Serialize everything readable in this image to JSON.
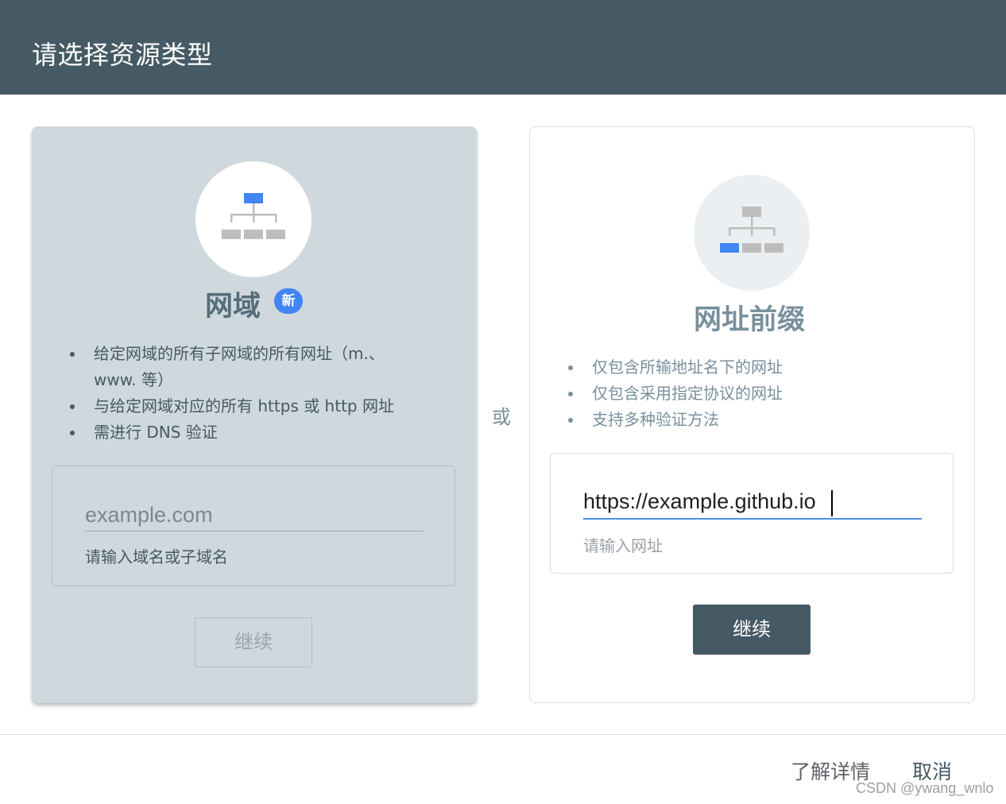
{
  "header": {
    "title": "请选择资源类型"
  },
  "domain_card": {
    "title": "网域",
    "badge": "新",
    "bullets": [
      "给定网域的所有子网域的所有网址（m.、www. 等）",
      "与给定网域对应的所有 https 或 http 网址",
      "需进行 DNS 验证"
    ],
    "input": {
      "placeholder": "example.com",
      "value": ""
    },
    "helper": "请输入域名或子域名",
    "continue_label": "继续",
    "icon": "sitemap-icon-top-highlight"
  },
  "separator": {
    "or_label": "或"
  },
  "prefix_card": {
    "title": "网址前缀",
    "bullets": [
      "仅包含所输地址名下的网址",
      "仅包含采用指定协议的网址",
      "支持多种验证方法"
    ],
    "input": {
      "placeholder": "",
      "value": "https://example.github.io"
    },
    "helper": "请输入网址",
    "continue_label": "继续",
    "icon": "sitemap-icon-bottom-highlight"
  },
  "footer": {
    "learn_more_label": "了解详情",
    "cancel_label": "取消"
  },
  "watermark": "CSDN @ywang_wnlo",
  "colors": {
    "header_bg": "#455a64",
    "domain_card_bg": "#cfd8dc",
    "highlight_blue": "#4285f4",
    "primary_button": "#455a64",
    "input_underline_active": "#4a90e2"
  }
}
